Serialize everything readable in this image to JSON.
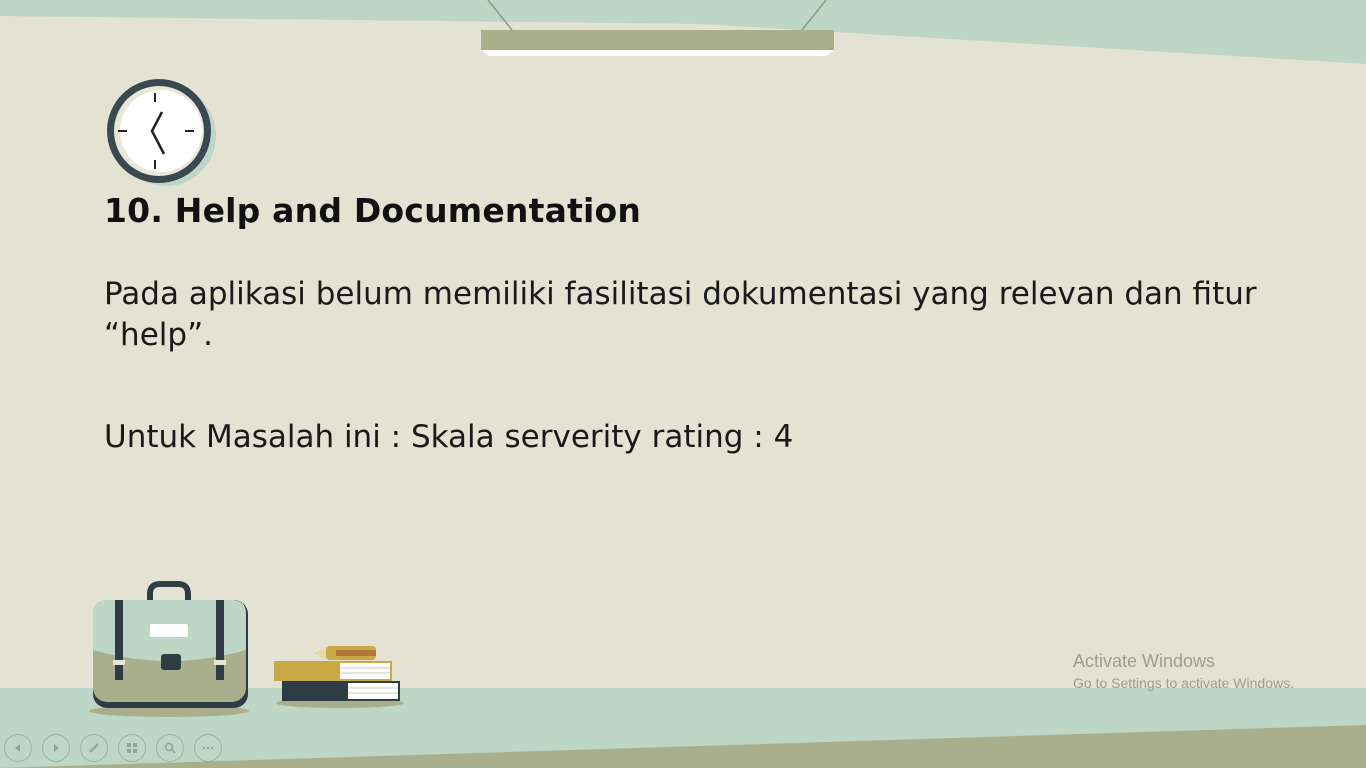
{
  "slide": {
    "title": "10. Help and Documentation",
    "paragraph_1": "Pada aplikasi belum memiliki fasilitasi dokumentasi yang relevan dan fitur “help”.",
    "paragraph_2": "Untuk Masalah ini : Skala serverity rating : 4"
  },
  "watermark": {
    "title": "Activate Windows",
    "subtitle": "Go to Settings to activate Windows."
  },
  "controls": [
    {
      "name": "previous-slide-button",
      "icon": "arrow-left-icon"
    },
    {
      "name": "next-slide-button",
      "icon": "arrow-right-icon"
    },
    {
      "name": "pen-tool-button",
      "icon": "pen-icon"
    },
    {
      "name": "slide-sorter-button",
      "icon": "grid-icon"
    },
    {
      "name": "zoom-button",
      "icon": "magnifier-icon"
    },
    {
      "name": "more-options-button",
      "icon": "ellipsis-icon"
    }
  ],
  "colors": {
    "background": "#e3e2d3",
    "accent_green": "#bed6c6",
    "olive": "#a9ae8c",
    "dark_slate": "#2e3c44"
  }
}
